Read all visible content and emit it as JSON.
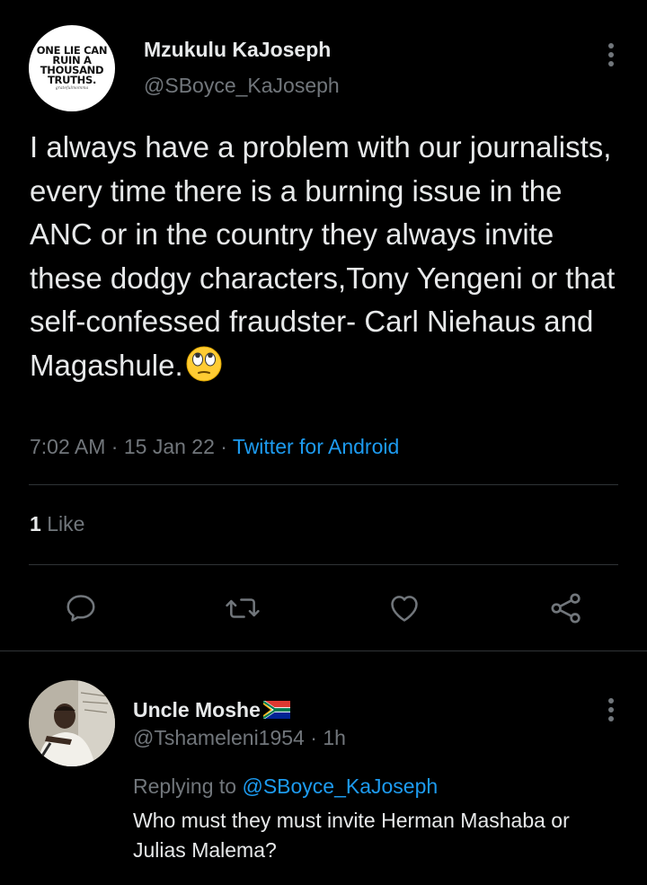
{
  "tweet": {
    "author_name": "Mzukulu KaJoseph",
    "author_handle": "@SBoyce_KaJoseph",
    "avatar_logo_lines": [
      "ONE LIE CAN",
      "RUIN A",
      "THOUSAND",
      "TRUTHS."
    ],
    "avatar_logo_script": "gratefulmomma",
    "text": "I always have a problem with our journalists, every time there is a burning issue in the ANC or in the country they always invite these dodgy characters,Tony Yengeni or that self-confessed fraudster- Carl Niehaus and Magashule.",
    "emoji": "face-with-rolling-eyes",
    "time": "7:02 AM",
    "date": "15 Jan 22",
    "app": "Twitter for Android",
    "separator": "·",
    "like_count": "1",
    "like_label": "Like",
    "actions": [
      "reply-icon",
      "retweet-icon",
      "like-icon",
      "share-icon"
    ]
  },
  "reply": {
    "author_name": "Uncle Moshe",
    "flag": "south-africa-flag",
    "author_handle": "@Tshameleni1954",
    "age": "1h",
    "replying_label": "Replying to",
    "replying_mention": "@SBoyce_KaJoseph",
    "text": "Who must they must invite Herman Mashaba or Julias Malema?"
  },
  "colors": {
    "background": "#000000",
    "text": "#e7e9ea",
    "secondary": "#71767b",
    "accent": "#1d9bf0",
    "divider": "#2f3336"
  }
}
